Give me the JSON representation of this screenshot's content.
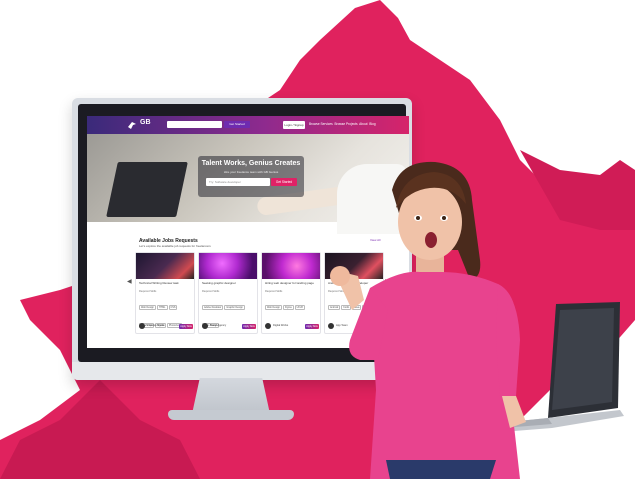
{
  "site": {
    "logo_text": "GB",
    "search_button": "Get Started",
    "login": "Login / Signup",
    "nav": [
      "Browse Services",
      "Browse Projects",
      "About",
      "Blog"
    ]
  },
  "hero": {
    "title": "Talent Works, Genius Creates",
    "subtitle": "Hire your freelance team with GB Genius",
    "placeholder": "Try: Software developer",
    "button": "Get Started"
  },
  "jobs": {
    "title": "Available Jobs Requests",
    "subtitle": "Let's explore the available job requests for freelancers",
    "view_all": "View All",
    "cards": [
      {
        "title": "Technical Writing Review task",
        "label": "Required Skills",
        "tags": [
          "Web Design",
          "HTML",
          "CSS",
          "JavaScript",
          "Figma",
          "Photoshop"
        ],
        "name": "Creative Studio",
        "apply": "Apply Now",
        "thumb": "phones"
      },
      {
        "title": "Seeking graphic designer",
        "label": "Required Skills",
        "tags": [
          "Adobe Illustrator",
          "Graphic Design",
          "Logo Design"
        ],
        "name": "Brand Agency",
        "apply": "Apply Now",
        "thumb": "abstract"
      },
      {
        "title": "Hiring web designer for landing page",
        "label": "Required Skills",
        "tags": [
          "Web Design",
          "Figma",
          "UI/UX"
        ],
        "name": "Digital Works",
        "apply": "Apply Now",
        "thumb": "abstract"
      },
      {
        "title": "Android Application Developer",
        "label": "Required Skills",
        "tags": [
          "Android",
          "Kotlin",
          "Java",
          "Firebase"
        ],
        "name": "App Team",
        "apply": "Apply Now",
        "thumb": "phones"
      }
    ]
  },
  "colors": {
    "splash": "#e0225e",
    "header_start": "#3a2a7a",
    "header_end": "#d6246a",
    "shirt": "#e8438e"
  }
}
